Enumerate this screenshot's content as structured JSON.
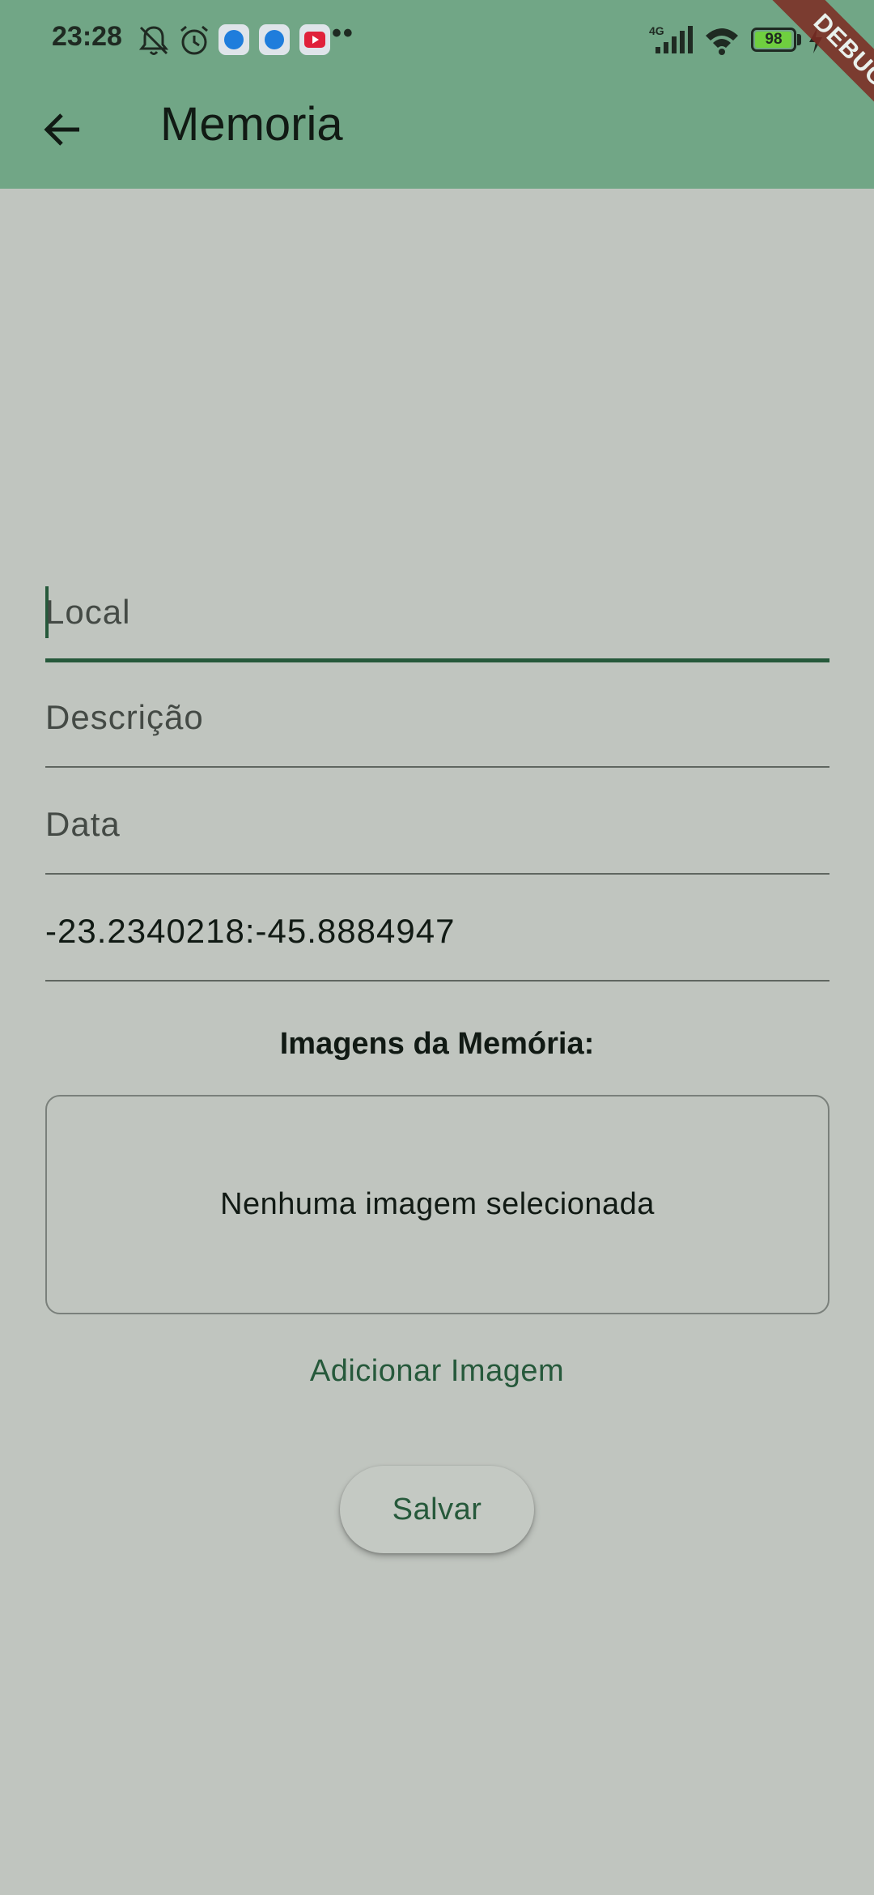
{
  "status_bar": {
    "time": "23:28",
    "network": "4G",
    "battery": "98",
    "battery_level": 0.98,
    "overflow_dots": "••",
    "icons": [
      "mute-icon",
      "alarm-icon",
      "browser-app-icon",
      "browser-app-icon",
      "youtube-app-icon",
      "signal-icon",
      "wifi-icon",
      "battery-icon",
      "charging-icon"
    ]
  },
  "app_bar": {
    "title": "Memoria",
    "back_icon": "arrow-left-icon"
  },
  "debug_banner": "DEBUG",
  "form": {
    "local": {
      "placeholder": "Local",
      "value": ""
    },
    "descricao": {
      "placeholder": "Descrição",
      "value": ""
    },
    "data": {
      "placeholder": "Data",
      "value": ""
    },
    "coordenadas": {
      "value": "-23.2340218:-45.8884947"
    }
  },
  "images": {
    "title": "Imagens da Memória:",
    "empty_text": "Nenhuma imagem selecionada",
    "add_button": "Adicionar Imagem"
  },
  "save_button": "Salvar",
  "colors": {
    "app_bar": "#71a686",
    "background": "#c0c5bf",
    "accent": "#26593b",
    "debug_ribbon": "#7d2a22"
  }
}
